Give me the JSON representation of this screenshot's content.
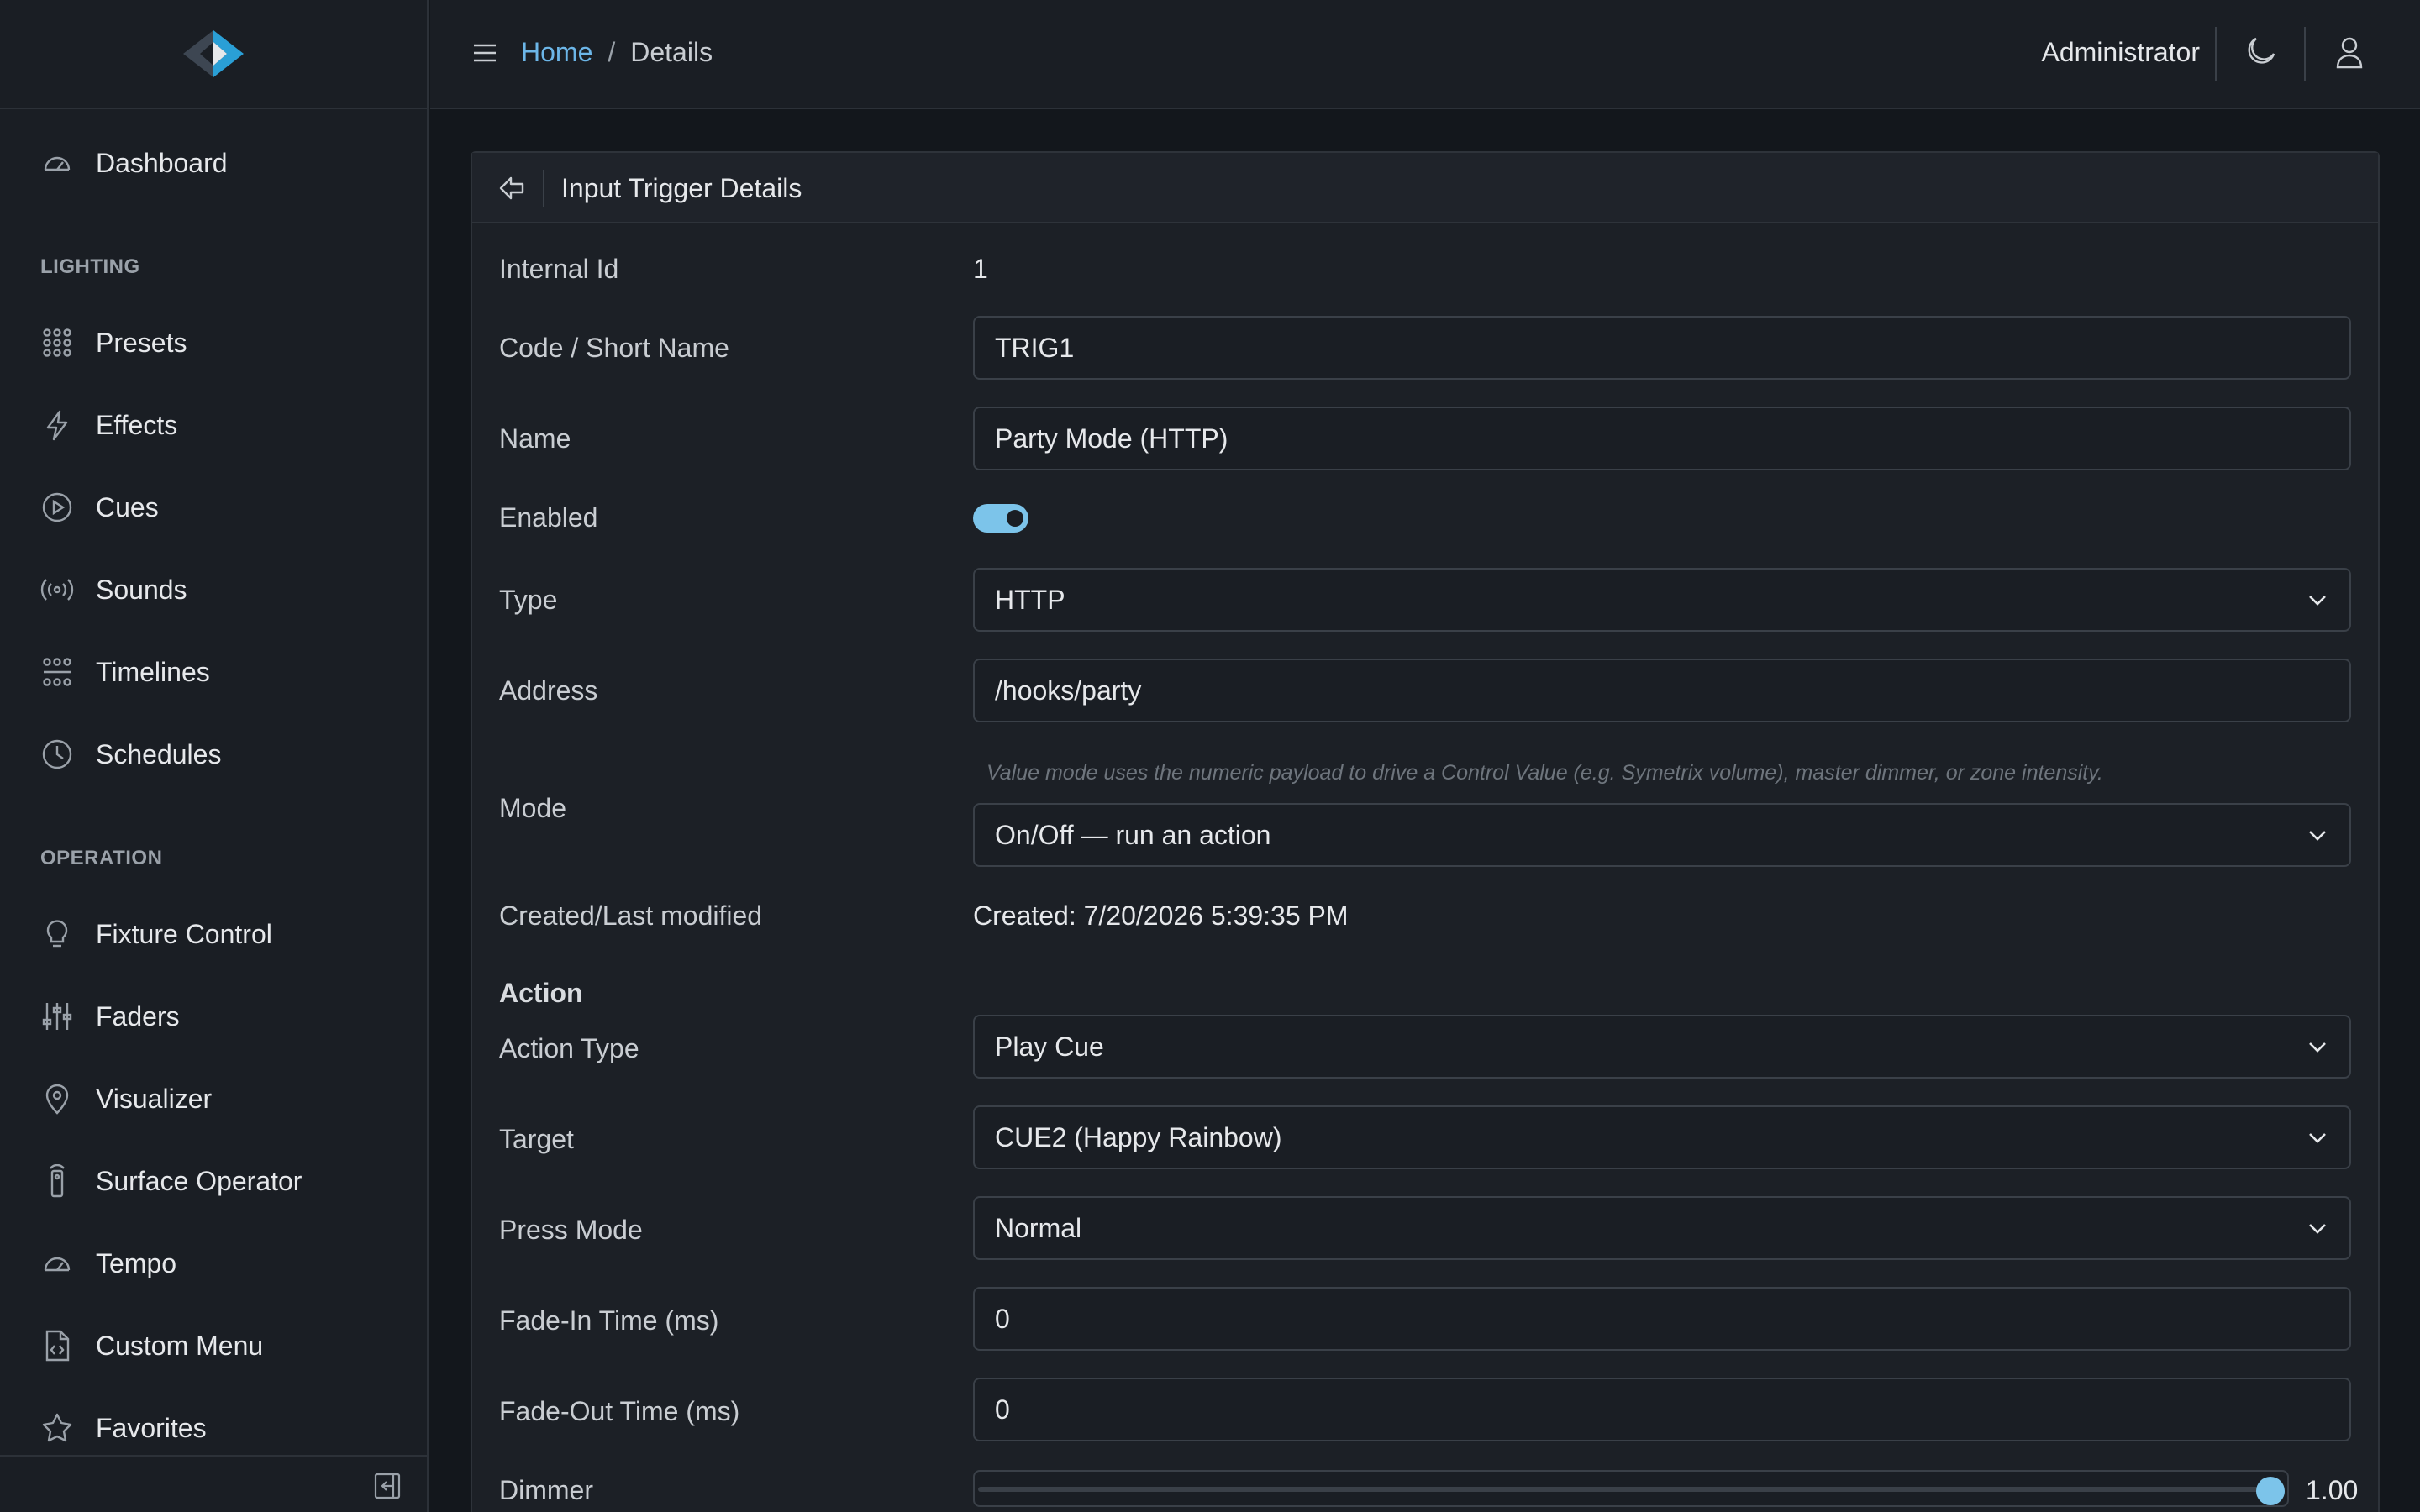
{
  "sidebar": {
    "items": [
      {
        "label": "Dashboard",
        "icon": "gauge-icon"
      },
      {
        "label": "Presets",
        "icon": "grid-icon"
      },
      {
        "label": "Effects",
        "icon": "lightning-icon"
      },
      {
        "label": "Cues",
        "icon": "play-circle-icon"
      },
      {
        "label": "Sounds",
        "icon": "broadcast-icon"
      },
      {
        "label": "Timelines",
        "icon": "timeline-icon"
      },
      {
        "label": "Schedules",
        "icon": "clock-icon"
      },
      {
        "label": "Fixture Control",
        "icon": "bulb-icon"
      },
      {
        "label": "Faders",
        "icon": "sliders-icon"
      },
      {
        "label": "Visualizer",
        "icon": "pin-icon"
      },
      {
        "label": "Surface Operator",
        "icon": "remote-icon"
      },
      {
        "label": "Tempo",
        "icon": "gauge-icon"
      },
      {
        "label": "Custom Menu",
        "icon": "code-file-icon"
      },
      {
        "label": "Favorites",
        "icon": "star-icon"
      }
    ],
    "sections": {
      "lighting": "LIGHTING",
      "operation": "OPERATION"
    }
  },
  "header": {
    "breadcrumb_home": "Home",
    "breadcrumb_sep": "/",
    "breadcrumb_current": "Details",
    "user": "Administrator"
  },
  "card": {
    "title": "Input Trigger Details",
    "fields": {
      "internal_id_label": "Internal Id",
      "internal_id_value": "1",
      "code_label": "Code / Short Name",
      "code_value": "TRIG1",
      "name_label": "Name",
      "name_value": "Party Mode (HTTP)",
      "enabled_label": "Enabled",
      "enabled": true,
      "type_label": "Type",
      "type_value": "HTTP",
      "address_label": "Address",
      "address_value": "/hooks/party",
      "mode_hint": "Value mode uses the numeric payload to drive a Control Value (e.g. Symetrix volume), master dimmer, or zone intensity.",
      "mode_label": "Mode",
      "mode_value": "On/Off — run an action",
      "created_label": "Created/Last modified",
      "created_value": "Created: 7/20/2026 5:39:35 PM"
    },
    "action": {
      "heading": "Action",
      "action_type_label": "Action Type",
      "action_type_value": "Play Cue",
      "target_label": "Target",
      "target_value": "CUE2 (Happy Rainbow)",
      "press_mode_label": "Press Mode",
      "press_mode_value": "Normal",
      "fade_in_label": "Fade-In Time (ms)",
      "fade_in_value": "0",
      "fade_out_label": "Fade-Out Time (ms)",
      "fade_out_value": "0",
      "dimmer_label": "Dimmer",
      "dimmer_value": "1.00",
      "dimmer_fraction": 1.0
    }
  },
  "colors": {
    "accent": "#7cc4ea",
    "link": "#6cb6e8",
    "background": "#13171c"
  }
}
